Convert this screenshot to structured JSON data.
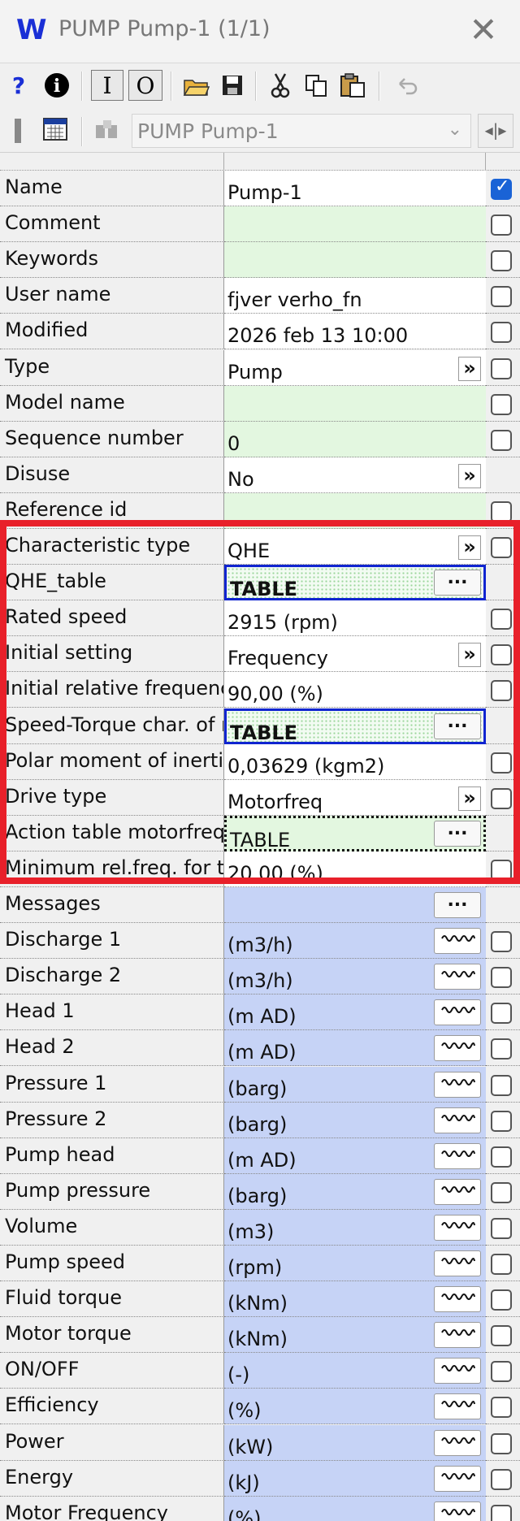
{
  "window": {
    "logo": "W",
    "title": "PUMP Pump-1 (1/1)",
    "close_glyph": "✕"
  },
  "toolbar": {
    "help": "?",
    "info": "i",
    "input_mode": "I",
    "output_mode": "O",
    "combo_value": "PUMP Pump-1"
  },
  "rows": [
    {
      "label": "Name",
      "value": "Pump-1",
      "style": "white",
      "checkbox": "checked"
    },
    {
      "label": "Comment",
      "value": "",
      "style": "green",
      "checkbox": "unchecked"
    },
    {
      "label": "Keywords",
      "value": "",
      "style": "green",
      "checkbox": "unchecked"
    },
    {
      "label": "User name",
      "value": "fjver verho_fn",
      "style": "white",
      "checkbox": "unchecked"
    },
    {
      "label": "Modified",
      "value": "2026 feb 13  10:00",
      "style": "white",
      "checkbox": "unchecked"
    },
    {
      "label": "Type",
      "value": "Pump",
      "style": "white",
      "button": "»",
      "checkbox": "unchecked"
    },
    {
      "label": "Model name",
      "value": "",
      "style": "green",
      "checkbox": "unchecked"
    },
    {
      "label": "Sequence number",
      "value": "0",
      "style": "green",
      "checkbox": "unchecked"
    },
    {
      "label": "Disuse",
      "value": "No",
      "style": "white",
      "button": "»",
      "checkbox": "none"
    },
    {
      "label": "Reference id",
      "value": "",
      "style": "green",
      "checkbox": "unchecked"
    },
    {
      "label": "Characteristic type",
      "value": "QHE",
      "style": "white",
      "button": "»",
      "checkbox": "unchecked"
    },
    {
      "label": "QHE_table",
      "value": "TABLE",
      "style": "table-blue",
      "button": "...",
      "checkbox": "none"
    },
    {
      "label": "Rated speed",
      "value": "2915 (rpm)",
      "style": "white",
      "checkbox": "unchecked"
    },
    {
      "label": "Initial setting",
      "value": "Frequency",
      "style": "white",
      "button": "»",
      "checkbox": "unchecked"
    },
    {
      "label": "Initial relative frequency",
      "value": "90,00 (%)",
      "style": "white",
      "checkbox": "unchecked"
    },
    {
      "label": "Speed-Torque char. of motor",
      "value": "TABLE",
      "style": "table-blue",
      "button": "...",
      "checkbox": "none"
    },
    {
      "label": "Polar moment of inertia",
      "value": "0,03629 (kgm2)",
      "style": "white",
      "checkbox": "unchecked"
    },
    {
      "label": "Drive type",
      "value": "Motorfreq",
      "style": "white",
      "button": "»",
      "checkbox": "unchecked"
    },
    {
      "label": "Action table motorfreq.",
      "value": "TABLE",
      "style": "table-black",
      "button": "...",
      "checkbox": "none"
    },
    {
      "label": "Minimum rel.freq. for trip",
      "value": "20,00 (%)",
      "style": "white",
      "checkbox": "unchecked"
    },
    {
      "label": "Messages",
      "value": "",
      "style": "blue",
      "button": "...",
      "checkbox": "none"
    },
    {
      "label": "Discharge 1",
      "value": "(m3/h)",
      "style": "blue",
      "button": "wave",
      "checkbox": "unchecked"
    },
    {
      "label": "Discharge 2",
      "value": "(m3/h)",
      "style": "blue",
      "button": "wave",
      "checkbox": "unchecked"
    },
    {
      "label": "Head 1",
      "value": "(m AD)",
      "style": "blue",
      "button": "wave",
      "checkbox": "unchecked"
    },
    {
      "label": "Head 2",
      "value": "(m AD)",
      "style": "blue",
      "button": "wave",
      "checkbox": "unchecked"
    },
    {
      "label": "Pressure 1",
      "value": "(barg)",
      "style": "blue",
      "button": "wave",
      "checkbox": "unchecked"
    },
    {
      "label": "Pressure 2",
      "value": "(barg)",
      "style": "blue",
      "button": "wave",
      "checkbox": "unchecked"
    },
    {
      "label": "Pump head",
      "value": "(m AD)",
      "style": "blue",
      "button": "wave",
      "checkbox": "unchecked"
    },
    {
      "label": "Pump pressure",
      "value": "(barg)",
      "style": "blue",
      "button": "wave",
      "checkbox": "unchecked"
    },
    {
      "label": "Volume",
      "value": "(m3)",
      "style": "blue",
      "button": "wave",
      "checkbox": "unchecked"
    },
    {
      "label": "Pump speed",
      "value": "(rpm)",
      "style": "blue",
      "button": "wave",
      "checkbox": "unchecked"
    },
    {
      "label": "Fluid torque",
      "value": "(kNm)",
      "style": "blue",
      "button": "wave",
      "checkbox": "unchecked"
    },
    {
      "label": "Motor torque",
      "value": "(kNm)",
      "style": "blue",
      "button": "wave",
      "checkbox": "unchecked"
    },
    {
      "label": "ON/OFF",
      "value": "(-)",
      "style": "blue",
      "button": "wave",
      "checkbox": "unchecked"
    },
    {
      "label": "Efficiency",
      "value": "(%)",
      "style": "blue",
      "button": "wave",
      "checkbox": "unchecked"
    },
    {
      "label": "Power",
      "value": "(kW)",
      "style": "blue",
      "button": "wave",
      "checkbox": "unchecked"
    },
    {
      "label": "Energy",
      "value": "(kJ)",
      "style": "blue",
      "button": "wave",
      "checkbox": "unchecked"
    },
    {
      "label": "Motor Frequency",
      "value": "(%)",
      "style": "blue",
      "button": "wave",
      "checkbox": "unchecked"
    }
  ],
  "colors": {
    "highlight": "#e8202a",
    "output_blue": "#c6d3f6",
    "input_green": "#e3f7e0",
    "checkbox_on": "#1a63d6"
  }
}
